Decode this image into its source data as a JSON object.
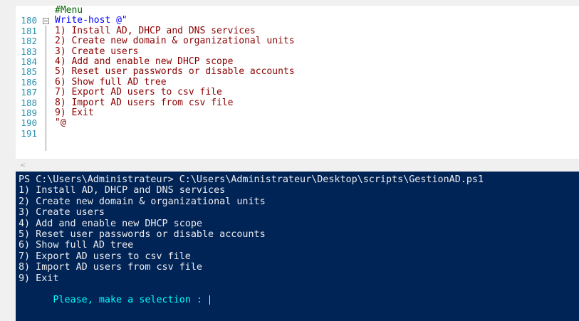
{
  "editor": {
    "lines": [
      {
        "num": "180",
        "text": "#Menu",
        "kind": "comment"
      },
      {
        "num": "181",
        "text": "Write-host @\"",
        "kind": "cmd"
      },
      {
        "num": "182",
        "text": "1) Install AD, DHCP and DNS services",
        "kind": "str"
      },
      {
        "num": "183",
        "text": "2) Create new domain & organizational units",
        "kind": "str"
      },
      {
        "num": "184",
        "text": "3) Create users",
        "kind": "str"
      },
      {
        "num": "185",
        "text": "4) Add and enable new DHCP scope",
        "kind": "str"
      },
      {
        "num": "186",
        "text": "5) Reset user passwords or disable accounts",
        "kind": "str"
      },
      {
        "num": "187",
        "text": "6) Show full AD tree",
        "kind": "str"
      },
      {
        "num": "188",
        "text": "7) Export AD users to csv file",
        "kind": "str"
      },
      {
        "num": "189",
        "text": "8) Import AD users from csv file",
        "kind": "str"
      },
      {
        "num": "190",
        "text": "9) Exit",
        "kind": "str"
      },
      {
        "num": "191",
        "text": "\"@",
        "kind": "str"
      }
    ],
    "scroll_arrow": "<"
  },
  "console": {
    "command": "PS C:\\Users\\Administrateur> C:\\Users\\Administrateur\\Desktop\\scripts\\GestionAD.ps1",
    "menu": [
      "1) Install AD, DHCP and DNS services",
      "2) Create new domain & organizational units",
      "3) Create users",
      "4) Add and enable new DHCP scope",
      "5) Reset user passwords or disable accounts",
      "6) Show full AD tree",
      "7) Export AD users to csv file",
      "8) Import AD users from csv file",
      "9) Exit"
    ],
    "prompt": "Please, make a selection : ",
    "colors": {
      "background": "#012456",
      "text": "#eeedf0",
      "prompt": "#00ffff"
    }
  }
}
